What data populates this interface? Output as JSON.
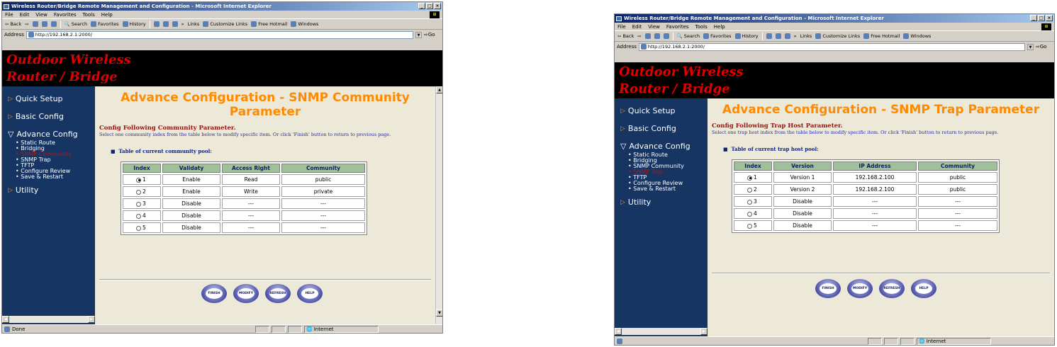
{
  "window": {
    "title": "Wireless Router/Bridge Remote Management and Configuration - Microsoft Internet Explorer",
    "controls": [
      "_",
      "□",
      "×"
    ]
  },
  "menu": [
    "File",
    "Edit",
    "View",
    "Favorites",
    "Tools",
    "Help"
  ],
  "toolbar": {
    "back": "Back",
    "search": "Search",
    "favorites": "Favorites",
    "history": "History",
    "links_label": "Links",
    "links": [
      "Customize Links",
      "Free Hotmail",
      "Windows"
    ]
  },
  "address": {
    "label": "Address",
    "url": "http://192.168.2.1:2000/",
    "go": "Go"
  },
  "banner": {
    "line1": "Outdoor Wireless",
    "line2": "Router / Bridge"
  },
  "nav": {
    "quick_setup": "Quick Setup",
    "basic_config": "Basic Config",
    "advance_config": "Advance Config",
    "sub_items": [
      "Static Route",
      "Bridging",
      "SNMP Community",
      "SNMP Trap",
      "TFTP",
      "Configure Review",
      "Save & Restart"
    ],
    "utility": "Utility"
  },
  "buttons": {
    "finish": "FINISH",
    "modify": "MODIFY",
    "refresh": "REFRESH",
    "help": "HELP"
  },
  "community": {
    "heading_line1": "Advance Configuration - SNMP Community",
    "heading_line2": "Parameter",
    "config_title": "Config Following Community Parameter.",
    "description": "Select one community index from the table below to modify specific item. Or click 'Finish' button to return to previous page.",
    "pool_label": "Table of current community pool:",
    "headers": [
      "Index",
      "Validaty",
      "Access Right",
      "Community"
    ],
    "rows": [
      {
        "index": "1",
        "selected": true,
        "validity": "Enable",
        "access": "Read",
        "community": "public"
      },
      {
        "index": "2",
        "selected": false,
        "validity": "Enable",
        "access": "Write",
        "community": "private"
      },
      {
        "index": "3",
        "selected": false,
        "validity": "Disable",
        "access": "---",
        "community": "---"
      },
      {
        "index": "4",
        "selected": false,
        "validity": "Disable",
        "access": "---",
        "community": "---"
      },
      {
        "index": "5",
        "selected": false,
        "validity": "Disable",
        "access": "---",
        "community": "---"
      }
    ],
    "status_text": "Done",
    "zone": "Internet"
  },
  "trap": {
    "heading": "Advance Configuration - SNMP Trap Parameter",
    "config_title": "Config Following Trap Host Parameter.",
    "description": "Select one trap host index from the table below to modify specific item. Or click 'Finish' button to return to previous page.",
    "pool_label": "Table of current trap host pool:",
    "headers": [
      "Index",
      "Version",
      "IP Address",
      "Community"
    ],
    "rows": [
      {
        "index": "1",
        "selected": true,
        "version": "Version 1",
        "ip": "192.168.2.100",
        "community": "public"
      },
      {
        "index": "2",
        "selected": false,
        "version": "Version 2",
        "ip": "192.168.2.100",
        "community": "public"
      },
      {
        "index": "3",
        "selected": false,
        "version": "Disable",
        "ip": "---",
        "community": "---"
      },
      {
        "index": "4",
        "selected": false,
        "version": "Disable",
        "ip": "---",
        "community": "---"
      },
      {
        "index": "5",
        "selected": false,
        "version": "Disable",
        "ip": "---",
        "community": "---"
      }
    ],
    "status_text": "",
    "zone": "Internet"
  },
  "colors": {
    "heading": "#ff8a00",
    "nav_bg": "#173563",
    "banner_text": "#e00000",
    "active_nav": "#b01818"
  }
}
